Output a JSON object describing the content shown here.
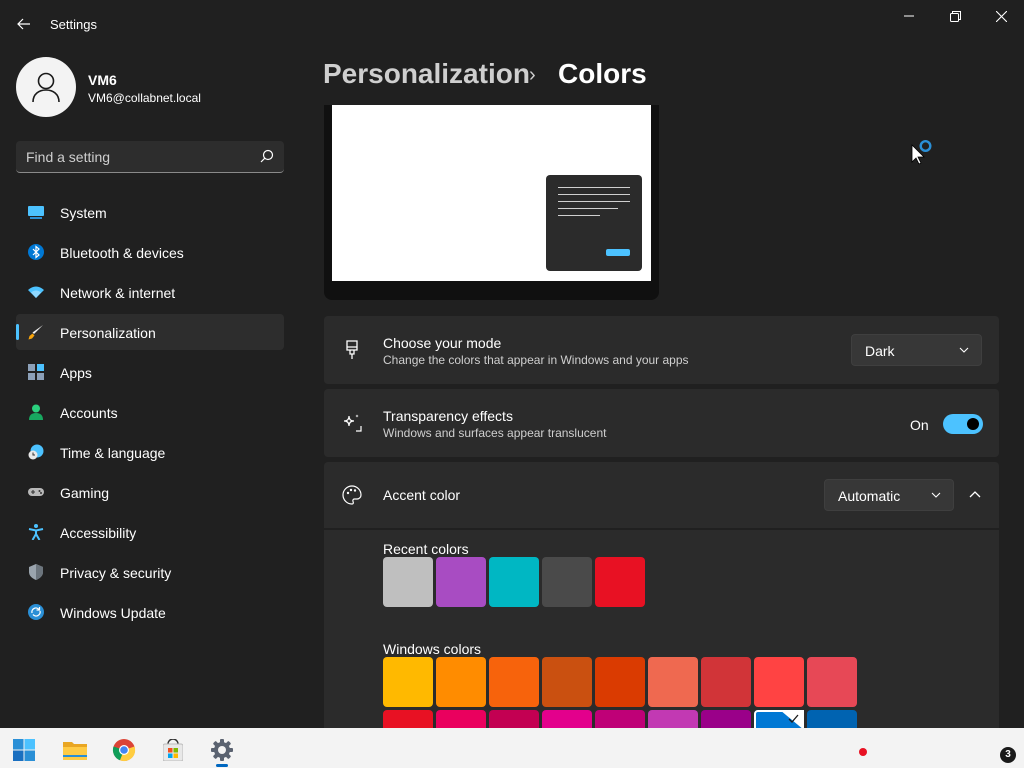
{
  "window": {
    "app_title": "Settings"
  },
  "profile": {
    "name": "VM6",
    "email": "VM6@collabnet.local"
  },
  "search": {
    "placeholder": "Find a setting"
  },
  "nav": {
    "items": [
      {
        "label": "System",
        "icon": "monitor-icon"
      },
      {
        "label": "Bluetooth & devices",
        "icon": "bluetooth-icon"
      },
      {
        "label": "Network & internet",
        "icon": "wifi-icon"
      },
      {
        "label": "Personalization",
        "icon": "brush-icon",
        "active": true
      },
      {
        "label": "Apps",
        "icon": "apps-icon"
      },
      {
        "label": "Accounts",
        "icon": "person-icon"
      },
      {
        "label": "Time & language",
        "icon": "clock-globe-icon"
      },
      {
        "label": "Gaming",
        "icon": "gamepad-icon"
      },
      {
        "label": "Accessibility",
        "icon": "accessibility-icon"
      },
      {
        "label": "Privacy & security",
        "icon": "shield-icon"
      },
      {
        "label": "Windows Update",
        "icon": "update-icon"
      }
    ]
  },
  "breadcrumb": {
    "parent": "Personalization",
    "separator": "›",
    "current": "Colors"
  },
  "mode_card": {
    "title": "Choose your mode",
    "description": "Change the colors that appear in Windows and your apps",
    "value": "Dark"
  },
  "transparency_card": {
    "title": "Transparency effects",
    "description": "Windows and surfaces appear translucent",
    "state_label": "On",
    "enabled": true
  },
  "accent_card": {
    "title": "Accent color",
    "value": "Automatic",
    "expanded": true
  },
  "recent_colors": {
    "label": "Recent colors",
    "colors": [
      "#bfbfbf",
      "#a84cc2",
      "#00b7c3",
      "#4a4a4a",
      "#e81123"
    ]
  },
  "windows_colors": {
    "label": "Windows colors",
    "row1": [
      "#ffb900",
      "#ff8c00",
      "#f7630c",
      "#ca5010",
      "#da3b01",
      "#ef6950",
      "#d13438",
      "#ff4343",
      "#e74856"
    ],
    "row2": [
      "#e81123",
      "#ea005e",
      "#c30052",
      "#e3008c",
      "#bf0077",
      "#c239b3",
      "#9a0089",
      "#0078d4",
      "#0063b1"
    ],
    "selected": "#0078d4"
  },
  "taskbar": {
    "apps": [
      "start-icon",
      "file-explorer-icon",
      "chrome-icon",
      "store-icon",
      "settings-gear-icon"
    ],
    "notification_count": "3"
  },
  "colors": {
    "accent": "#4cc2ff",
    "background": "#202020",
    "card": "#2b2b2b"
  }
}
